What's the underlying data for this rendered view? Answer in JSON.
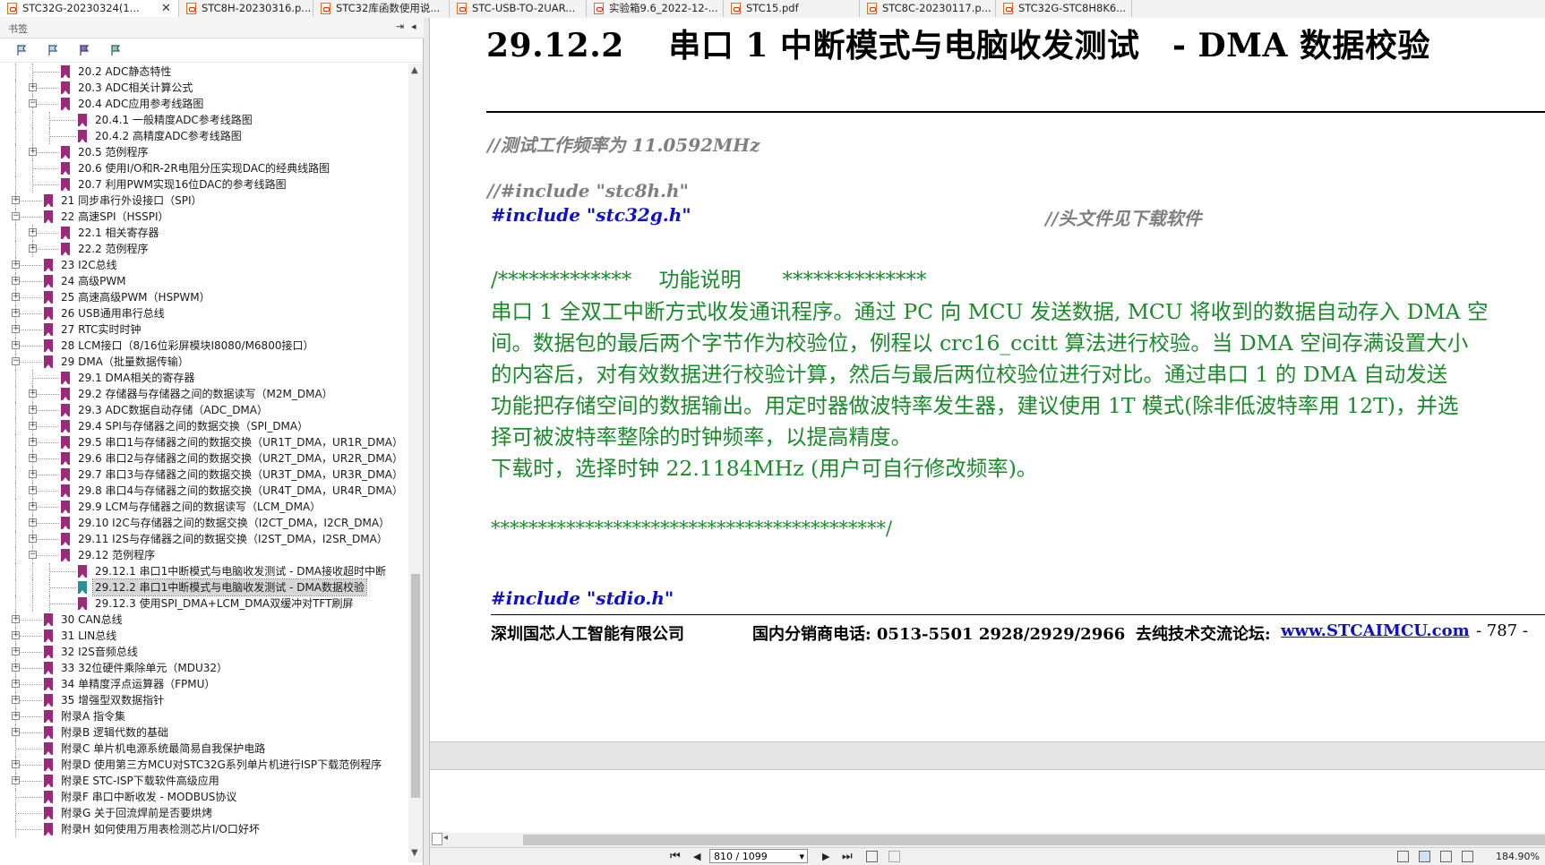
{
  "tabs": [
    {
      "label": "STC32G-20230324(1...",
      "close": "✕"
    },
    {
      "label": "STC8H-20230316.p..."
    },
    {
      "label": "STC32库函数使用说..."
    },
    {
      "label": "STC-USB-TO-2UAR..."
    },
    {
      "label": "实验箱9.6_2022-12-..."
    },
    {
      "label": "STC15.pdf"
    },
    {
      "label": "STC8C-20230117.p..."
    },
    {
      "label": "STC32G-STC8H8K6..."
    }
  ],
  "sidebar": {
    "title": "书签",
    "pin": "⇥",
    "collapse": "◂",
    "items": [
      {
        "label": "20.2 ADC静态特性",
        "level": 2,
        "exp": ""
      },
      {
        "label": "20.3 ADC相关计算公式",
        "level": 2,
        "exp": "+"
      },
      {
        "label": "20.4 ADC应用参考线路图",
        "level": 2,
        "exp": "-"
      },
      {
        "label": "20.4.1 一般精度ADC参考线路图",
        "level": 3,
        "exp": ""
      },
      {
        "label": "20.4.2 高精度ADC参考线路图",
        "level": 3,
        "exp": ""
      },
      {
        "label": "20.5 范例程序",
        "level": 2,
        "exp": "+"
      },
      {
        "label": "20.6 使用I/O和R-2R电阻分压实现DAC的经典线路图",
        "level": 2,
        "exp": ""
      },
      {
        "label": "20.7 利用PWM实现16位DAC的参考线路图",
        "level": 2,
        "exp": ""
      },
      {
        "label": "21 同步串行外设接口（SPI）",
        "level": 1,
        "exp": "+"
      },
      {
        "label": "22 高速SPI（HSSPI）",
        "level": 1,
        "exp": "-"
      },
      {
        "label": "22.1 相关寄存器",
        "level": 2,
        "exp": "+"
      },
      {
        "label": "22.2 范例程序",
        "level": 2,
        "exp": "+"
      },
      {
        "label": "23 I2C总线",
        "level": 1,
        "exp": "+"
      },
      {
        "label": "24 高级PWM",
        "level": 1,
        "exp": "+"
      },
      {
        "label": "25 高速高级PWM（HSPWM）",
        "level": 1,
        "exp": "+"
      },
      {
        "label": "26 USB通用串行总线",
        "level": 1,
        "exp": "+"
      },
      {
        "label": "27 RTC实时时钟",
        "level": 1,
        "exp": "+"
      },
      {
        "label": "28 LCM接口（8/16位彩屏模块I8080/M6800接口）",
        "level": 1,
        "exp": "+"
      },
      {
        "label": "29 DMA（批量数据传输）",
        "level": 1,
        "exp": "-"
      },
      {
        "label": "29.1 DMA相关的寄存器",
        "level": 2,
        "exp": ""
      },
      {
        "label": "29.2 存储器与存储器之间的数据读写（M2M_DMA）",
        "level": 2,
        "exp": "+"
      },
      {
        "label": "29.3 ADC数据自动存储（ADC_DMA）",
        "level": 2,
        "exp": "+"
      },
      {
        "label": "29.4 SPI与存储器之间的数据交换（SPI_DMA）",
        "level": 2,
        "exp": "+"
      },
      {
        "label": "29.5 串口1与存储器之间的数据交换（UR1T_DMA，UR1R_DMA）",
        "level": 2,
        "exp": "+"
      },
      {
        "label": "29.6 串口2与存储器之间的数据交换（UR2T_DMA，UR2R_DMA）",
        "level": 2,
        "exp": "+"
      },
      {
        "label": "29.7 串口3与存储器之间的数据交换（UR3T_DMA，UR3R_DMA）",
        "level": 2,
        "exp": "+"
      },
      {
        "label": "29.8 串口4与存储器之间的数据交换（UR4T_DMA，UR4R_DMA）",
        "level": 2,
        "exp": "+"
      },
      {
        "label": "29.9 LCM与存储器之间的数据读写（LCM_DMA）",
        "level": 2,
        "exp": "+"
      },
      {
        "label": "29.10 I2C与存储器之间的数据交换（I2CT_DMA，I2CR_DMA）",
        "level": 2,
        "exp": "+"
      },
      {
        "label": "29.11 I2S与存储器之间的数据交换（I2ST_DMA，I2SR_DMA）",
        "level": 2,
        "exp": "+"
      },
      {
        "label": "29.12 范例程序",
        "level": 2,
        "exp": "-"
      },
      {
        "label": "29.12.1 串口1中断模式与电脑收发测试 - DMA接收超时中断",
        "level": 3,
        "exp": ""
      },
      {
        "label": "29.12.2 串口1中断模式与电脑收发测试 - DMA数据校验",
        "level": 3,
        "exp": "",
        "selected": true
      },
      {
        "label": "29.12.3 使用SPI_DMA+LCM_DMA双缓冲对TFT刷屏",
        "level": 3,
        "exp": ""
      },
      {
        "label": "30 CAN总线",
        "level": 1,
        "exp": "+"
      },
      {
        "label": "31 LIN总线",
        "level": 1,
        "exp": "+"
      },
      {
        "label": "32 I2S音频总线",
        "level": 1,
        "exp": "+"
      },
      {
        "label": "33 32位硬件乘除单元（MDU32）",
        "level": 1,
        "exp": "+"
      },
      {
        "label": "34 单精度浮点运算器（FPMU）",
        "level": 1,
        "exp": "+"
      },
      {
        "label": "35 增强型双数据指针",
        "level": 1,
        "exp": "+"
      },
      {
        "label": "附录A 指令集",
        "level": 1,
        "exp": "+"
      },
      {
        "label": "附录B 逻辑代数的基础",
        "level": 1,
        "exp": "+"
      },
      {
        "label": "附录C 单片机电源系统最简易自我保护电路",
        "level": 1,
        "exp": ""
      },
      {
        "label": "附录D 使用第三方MCU对STC32G系列单片机进行ISP下载范例程序",
        "level": 1,
        "exp": "+"
      },
      {
        "label": "附录E STC-ISP下载软件高级应用",
        "level": 1,
        "exp": "+"
      },
      {
        "label": "附录F 串口中断收发 - MODBUS协议",
        "level": 1,
        "exp": ""
      },
      {
        "label": "附录G 关于回流焊前是否要烘烤",
        "level": 1,
        "exp": ""
      },
      {
        "label": "附录H 如何使用万用表检测芯片I/O口好坏",
        "level": 1,
        "exp": ""
      }
    ]
  },
  "doc": {
    "heading": "29.12.2　 串口 1 中断模式与电脑收发测试　- DMA 数据校验",
    "comment_freq": "//测试工作频率为 11.0592MHz",
    "comment_include": "//#include \"stc8h.h\"",
    "include_stc32g": "#include \"stc32g.h\"",
    "comment_header": "//头文件见下载软件",
    "func_desc_head": "/*************　 功能说明　　**************",
    "body_lines": [
      "串口 1 全双工中断方式收发通讯程序。通过 PC 向 MCU 发送数据, MCU 将收到的数据自动存入 DMA 空",
      "间。数据包的最后两个字节作为校验位，例程以 crc16_ccitt 算法进行校验。当 DMA 空间存满设置大小",
      "的内容后，对有效数据进行校验计算，然后与最后两位校验位进行对比。通过串口 1 的 DMA 自动发送",
      "功能把存储空间的数据输出。用定时器做波特率发生器，建议使用 1T 模式(除非低波特率用 12T)，并选",
      "择可被波特率整除的时钟频率，以提高精度。",
      "下载时，选择时钟 22.1184MHz (用户可自行修改频率)。"
    ],
    "stars_end": "******************************************/",
    "include_stdio": "#include \"stdio.h\"",
    "footer_company": "深圳国芯人工智能有限公司",
    "footer_phone": "国内分销商电话: 0513-5501 2928/2929/2966",
    "footer_forum": "去纯技术交流论坛:",
    "footer_link": "www.STCAIMCU.com",
    "footer_page": "- 787 -"
  },
  "status": {
    "first": "⏮",
    "prev": "◀",
    "page": "810 / 1099",
    "dropdown": "▾",
    "next": "▶",
    "last": "⏭",
    "zoom": "184.90%"
  },
  "colors": {
    "bookmark": "#9b2a7b",
    "selected_bookmark": "#2a8f9b",
    "code_green": "#1a8a2a",
    "include_blue": "#1010c8",
    "comment_gray": "#7f7f7f"
  }
}
